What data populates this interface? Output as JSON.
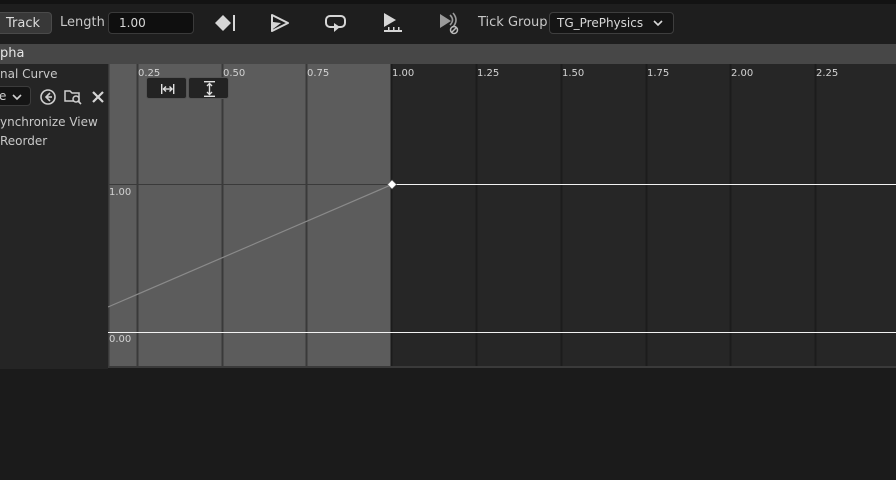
{
  "toolbar": {
    "track_button": "Track",
    "length_label": "Length",
    "length_value": "1.00",
    "tick_group_label": "Tick Group",
    "tick_group_value": "TG_PrePhysics",
    "icons": [
      "add-key-icon",
      "play-icon",
      "loop-icon",
      "play-range-icon",
      "replicate-icon"
    ]
  },
  "track": {
    "name": "pha",
    "curve_label": "nal Curve",
    "curve_dropdown_value": "e",
    "synchronize_view": "ynchronize View",
    "reorder": "Reorder"
  },
  "graph": {
    "x_ticks": [
      "0.25",
      "0.50",
      "0.75",
      "1.00",
      "1.25",
      "1.50",
      "1.75",
      "2.00",
      "2.25"
    ],
    "y_labels": [
      "1.00",
      "0.00"
    ],
    "colors": {
      "active_range": "#5c5c5c",
      "inactive_range": "#262626",
      "curve": "#ffffff",
      "key": "#ffffff"
    }
  }
}
